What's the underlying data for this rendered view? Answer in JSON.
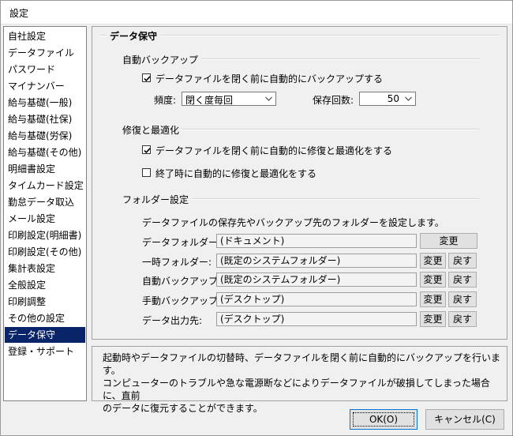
{
  "window": {
    "title": "設定"
  },
  "sidebar": {
    "items": [
      {
        "label": "自社設定"
      },
      {
        "label": "データファイル"
      },
      {
        "label": "パスワード"
      },
      {
        "label": "マイナンバー"
      },
      {
        "label": "給与基礎(一般)"
      },
      {
        "label": "給与基礎(社保)"
      },
      {
        "label": "給与基礎(労保)"
      },
      {
        "label": "給与基礎(その他)"
      },
      {
        "label": "明細書設定"
      },
      {
        "label": "タイムカード設定"
      },
      {
        "label": "勤怠データ取込"
      },
      {
        "label": "メール設定"
      },
      {
        "label": "印刷設定(明細書)"
      },
      {
        "label": "印刷設定(その他)"
      },
      {
        "label": "集計表設定"
      },
      {
        "label": "全般設定"
      },
      {
        "label": "印刷調整"
      },
      {
        "label": "その他の設定"
      },
      {
        "label": "データ保守"
      },
      {
        "label": "登録・サポート"
      }
    ],
    "selected": "データ保守"
  },
  "content": {
    "title": "データ保守",
    "auto_backup": {
      "section_title": "自動バックアップ",
      "checkbox_label": "データファイルを閉く前に自動的にバックアップする",
      "checked": true,
      "frequency_label": "頻度:",
      "frequency_value": "閉く度毎回",
      "count_label": "保存回数:",
      "count_value": "50"
    },
    "repair": {
      "section_title": "修復と最適化",
      "before_close_label": "データファイルを閉く前に自動的に修復と最適化をする",
      "before_close_checked": true,
      "on_exit_label": "終了時に自動的に修復と最適化をする",
      "on_exit_checked": false
    },
    "folders": {
      "section_title": "フォルダー設定",
      "description": "データファイルの保存先やバックアップ先のフォルダーを設定します。",
      "change_label": "変更",
      "reset_label": "戻す",
      "rows": [
        {
          "label": "データフォルダー:",
          "value": "(ドキュメント)"
        },
        {
          "label": "一時フォルダー:",
          "value": "(既定のシステムフォルダー)"
        },
        {
          "label": "自動バックアップ:",
          "value": "(既定のシステムフォルダー)"
        },
        {
          "label": "手動バックアップ:",
          "value": "(デスクトップ)"
        },
        {
          "label": "データ出力先:",
          "value": "(デスクトップ)"
        }
      ]
    }
  },
  "description": {
    "lines": [
      "起動時やデータファイルの切替時、データファイルを閉く前に自動的にバックアップを行います。",
      "コンピューターのトラブルや急な電源断などによりデータファイルが破損してしまった場合に、直前",
      "のデータに復元することができます。"
    ]
  },
  "footer": {
    "ok_label": "OK(O)",
    "cancel_label": "キャンセル(C)"
  },
  "colors": {
    "selection": "#0a246a",
    "focus_border": "#0078d7"
  }
}
